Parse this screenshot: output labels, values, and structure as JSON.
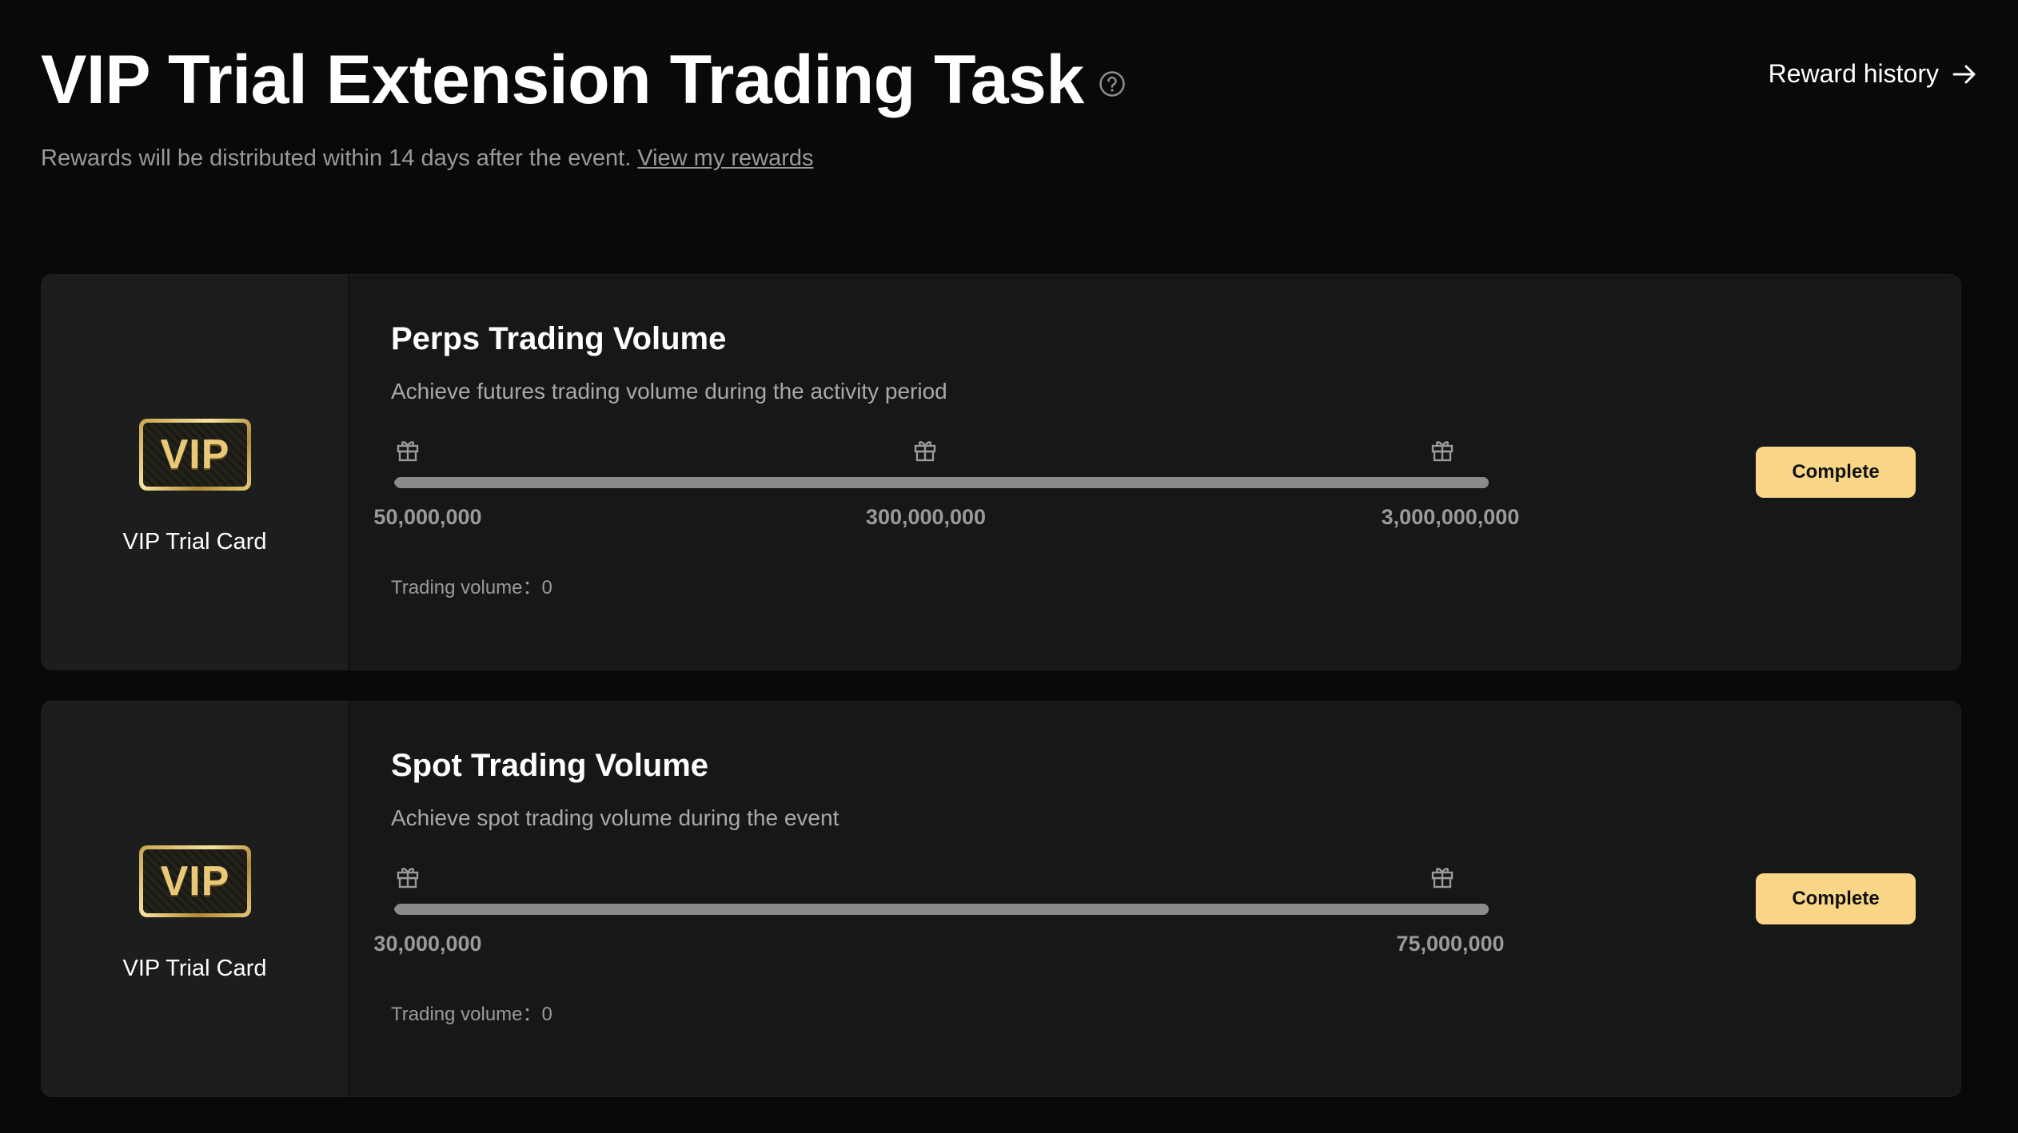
{
  "header": {
    "title": "VIP Trial Extension Trading Task",
    "help_icon": "question-circle-icon",
    "reward_history_label": "Reward history",
    "arrow_icon": "arrow-right-icon",
    "subtitle": "Rewards will be distributed within 14 days after the event.",
    "subtitle_link": "View my rewards"
  },
  "colors": {
    "background": "#090909",
    "card": "#161717",
    "accent_button": "#fad788",
    "progress_track": "#8b8b8b"
  },
  "tasks": [
    {
      "reward_icon": "vip-badge",
      "reward_badge_text": "VIP",
      "reward_name": "VIP Trial Card",
      "title": "Perps Trading Volume",
      "description": "Achieve futures trading volume during the activity period",
      "milestones": [
        "50,000,000",
        "300,000,000",
        "3,000,000,000"
      ],
      "milestone_icon": "gift-icon",
      "progress": 0,
      "volume_label": "Trading volume：0",
      "button_label": "Complete"
    },
    {
      "reward_icon": "vip-badge",
      "reward_badge_text": "VIP",
      "reward_name": "VIP Trial Card",
      "title": "Spot Trading Volume",
      "description": "Achieve spot trading volume during the event",
      "milestones": [
        "30,000,000",
        "75,000,000"
      ],
      "milestone_icon": "gift-icon",
      "progress": 0,
      "volume_label": "Trading volume：0",
      "button_label": "Complete"
    }
  ]
}
